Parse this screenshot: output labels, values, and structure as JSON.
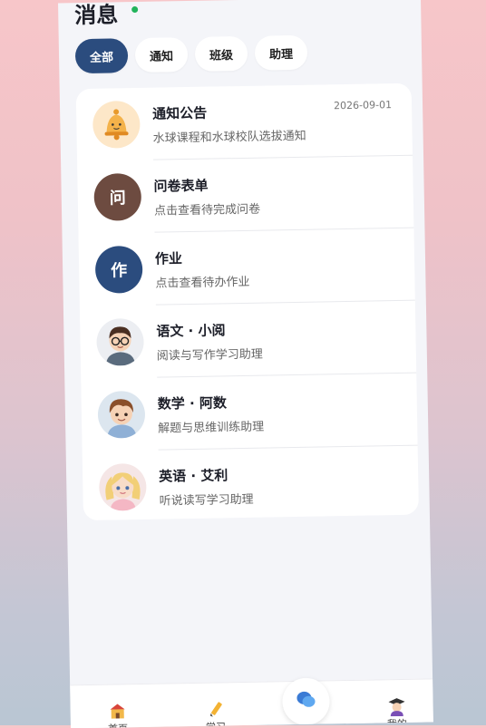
{
  "page": {
    "title": "消息"
  },
  "filters": [
    {
      "label": "全部",
      "active": true
    },
    {
      "label": "通知",
      "active": false
    },
    {
      "label": "班级",
      "active": false
    },
    {
      "label": "助理",
      "active": false
    }
  ],
  "messages": [
    {
      "title": "通知公告",
      "subtitle": "水球课程和水球校队选拔通知",
      "date": "2026-09-01",
      "icon": "bell-icon"
    },
    {
      "title": "问卷表单",
      "subtitle": "点击查看待完成问卷",
      "glyph": "问",
      "color": "#6d4b40"
    },
    {
      "title": "作业",
      "subtitle": "点击查看待办作业",
      "glyph": "作",
      "color": "#2b4c7e"
    },
    {
      "title": "语文 · 小阅",
      "subtitle": "阅读与写作学习助理",
      "icon": "boy-glasses-avatar"
    },
    {
      "title": "数学 · 阿数",
      "subtitle": "解题与思维训练助理",
      "icon": "boy-avatar"
    },
    {
      "title": "英语 · 艾利",
      "subtitle": "听说读写学习助理",
      "icon": "girl-avatar"
    }
  ],
  "nav": [
    {
      "label": "首页",
      "icon": "school-icon"
    },
    {
      "label": "学习",
      "icon": "pencil-icon"
    },
    {
      "label": "",
      "icon": "chat-bubbles-icon"
    },
    {
      "label": "我的",
      "icon": "graduate-icon"
    }
  ]
}
